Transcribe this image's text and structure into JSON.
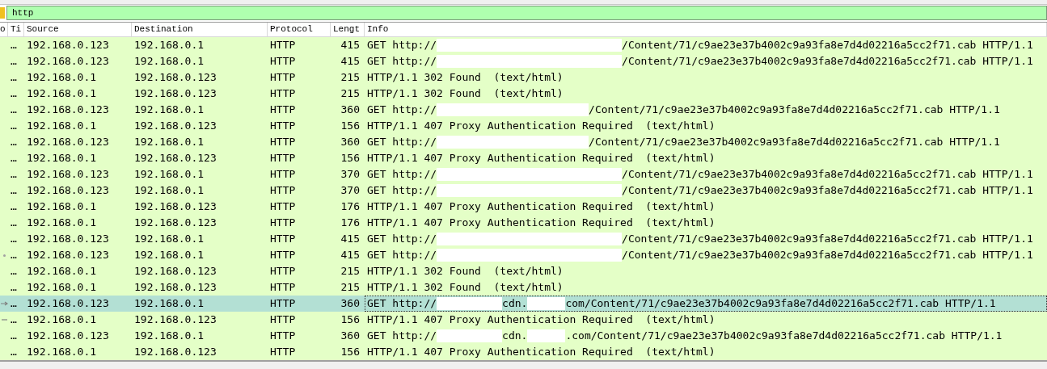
{
  "filter_bar": {
    "value": "http"
  },
  "table": {
    "columns": [
      "o",
      "Ti",
      "Source",
      "Destination",
      "Protocol",
      "Lengt",
      "Info"
    ],
    "rows": [
      {
        "time": "…",
        "source": "192.168.0.123",
        "destination": "192.168.0.1",
        "protocol": "HTTP",
        "length": "415",
        "selected": false,
        "info": [
          {
            "kind": "text",
            "text": "GET http://"
          },
          {
            "kind": "redaction-long"
          },
          {
            "kind": "text",
            "text": "/Content/71/c9ae23e37b4002c9a93fa8e7d4d02216a5cc2f71.cab HTTP/1.1"
          }
        ]
      },
      {
        "time": "…",
        "source": "192.168.0.123",
        "destination": "192.168.0.1",
        "protocol": "HTTP",
        "length": "415",
        "selected": false,
        "info": [
          {
            "kind": "text",
            "text": "GET http://"
          },
          {
            "kind": "redaction-long"
          },
          {
            "kind": "text",
            "text": "/Content/71/c9ae23e37b4002c9a93fa8e7d4d02216a5cc2f71.cab HTTP/1.1"
          }
        ]
      },
      {
        "time": "…",
        "source": "192.168.0.1",
        "destination": "192.168.0.123",
        "protocol": "HTTP",
        "length": "215",
        "selected": false,
        "info": [
          {
            "kind": "text",
            "text": "HTTP/1.1 302 Found  (text/html)"
          }
        ]
      },
      {
        "time": "…",
        "source": "192.168.0.1",
        "destination": "192.168.0.123",
        "protocol": "HTTP",
        "length": "215",
        "selected": false,
        "info": [
          {
            "kind": "text",
            "text": "HTTP/1.1 302 Found  (text/html)"
          }
        ]
      },
      {
        "time": "…",
        "source": "192.168.0.123",
        "destination": "192.168.0.1",
        "protocol": "HTTP",
        "length": "360",
        "selected": false,
        "info": [
          {
            "kind": "text",
            "text": "GET http://"
          },
          {
            "kind": "redaction-medium"
          },
          {
            "kind": "text",
            "text": "/Content/71/c9ae23e37b4002c9a93fa8e7d4d02216a5cc2f71.cab HTTP/1.1"
          }
        ]
      },
      {
        "time": "…",
        "source": "192.168.0.1",
        "destination": "192.168.0.123",
        "protocol": "HTTP",
        "length": "156",
        "selected": false,
        "info": [
          {
            "kind": "text",
            "text": "HTTP/1.1 407 Proxy Authentication Required  (text/html)"
          }
        ]
      },
      {
        "time": "…",
        "source": "192.168.0.123",
        "destination": "192.168.0.1",
        "protocol": "HTTP",
        "length": "360",
        "selected": false,
        "info": [
          {
            "kind": "text",
            "text": "GET http://"
          },
          {
            "kind": "redaction-medium"
          },
          {
            "kind": "text",
            "text": "/Content/71/c9ae23e37b4002c9a93fa8e7d4d02216a5cc2f71.cab HTTP/1.1"
          }
        ]
      },
      {
        "time": "…",
        "source": "192.168.0.1",
        "destination": "192.168.0.123",
        "protocol": "HTTP",
        "length": "156",
        "selected": false,
        "info": [
          {
            "kind": "text",
            "text": "HTTP/1.1 407 Proxy Authentication Required  (text/html)"
          }
        ]
      },
      {
        "time": "…",
        "source": "192.168.0.123",
        "destination": "192.168.0.1",
        "protocol": "HTTP",
        "length": "370",
        "selected": false,
        "info": [
          {
            "kind": "text",
            "text": "GET http://"
          },
          {
            "kind": "redaction-long"
          },
          {
            "kind": "text",
            "text": "/Content/71/c9ae23e37b4002c9a93fa8e7d4d02216a5cc2f71.cab HTTP/1.1"
          }
        ]
      },
      {
        "time": "…",
        "source": "192.168.0.123",
        "destination": "192.168.0.1",
        "protocol": "HTTP",
        "length": "370",
        "selected": false,
        "info": [
          {
            "kind": "text",
            "text": "GET http://"
          },
          {
            "kind": "redaction-long"
          },
          {
            "kind": "text",
            "text": "/Content/71/c9ae23e37b4002c9a93fa8e7d4d02216a5cc2f71.cab HTTP/1.1"
          }
        ]
      },
      {
        "time": "…",
        "source": "192.168.0.1",
        "destination": "192.168.0.123",
        "protocol": "HTTP",
        "length": "176",
        "selected": false,
        "info": [
          {
            "kind": "text",
            "text": "HTTP/1.1 407 Proxy Authentication Required  (text/html)"
          }
        ]
      },
      {
        "time": "…",
        "source": "192.168.0.1",
        "destination": "192.168.0.123",
        "protocol": "HTTP",
        "length": "176",
        "selected": false,
        "info": [
          {
            "kind": "text",
            "text": "HTTP/1.1 407 Proxy Authentication Required  (text/html)"
          }
        ]
      },
      {
        "time": "…",
        "source": "192.168.0.123",
        "destination": "192.168.0.1",
        "protocol": "HTTP",
        "length": "415",
        "selected": false,
        "info": [
          {
            "kind": "text",
            "text": "GET http://"
          },
          {
            "kind": "redaction-long"
          },
          {
            "kind": "text",
            "text": "/Content/71/c9ae23e37b4002c9a93fa8e7d4d02216a5cc2f71.cab HTTP/1.1"
          }
        ]
      },
      {
        "time": "…",
        "source": "192.168.0.123",
        "destination": "192.168.0.1",
        "protocol": "HTTP",
        "length": "415",
        "selected": false,
        "kind": "dot",
        "info": [
          {
            "kind": "text",
            "text": "GET http://"
          },
          {
            "kind": "redaction-long"
          },
          {
            "kind": "text",
            "text": "/Content/71/c9ae23e37b4002c9a93fa8e7d4d02216a5cc2f71.cab HTTP/1.1"
          }
        ]
      },
      {
        "time": "…",
        "source": "192.168.0.1",
        "destination": "192.168.0.123",
        "protocol": "HTTP",
        "length": "215",
        "selected": false,
        "info": [
          {
            "kind": "text",
            "text": "HTTP/1.1 302 Found  (text/html)"
          }
        ]
      },
      {
        "time": "…",
        "source": "192.168.0.1",
        "destination": "192.168.0.123",
        "protocol": "HTTP",
        "length": "215",
        "selected": false,
        "info": [
          {
            "kind": "text",
            "text": "HTTP/1.1 302 Found  (text/html)"
          }
        ]
      },
      {
        "time": "…",
        "source": "192.168.0.123",
        "destination": "192.168.0.1",
        "protocol": "HTTP",
        "length": "360",
        "selected": true,
        "kind": "arrow",
        "info": [
          {
            "kind": "text",
            "text": "GET http://"
          },
          {
            "kind": "redaction-short"
          },
          {
            "kind": "text",
            "text": "cdn."
          },
          {
            "kind": "redaction-tiny"
          },
          {
            "kind": "text",
            "text": "com/Content/71/c9ae23e37b4002c9a93fa8e7d4d02216a5cc2f71.cab HTTP/1.1"
          }
        ]
      },
      {
        "time": "…",
        "source": "192.168.0.1",
        "destination": "192.168.0.123",
        "protocol": "HTTP",
        "length": "156",
        "selected": false,
        "kind": "line",
        "info": [
          {
            "kind": "text",
            "text": "HTTP/1.1 407 Proxy Authentication Required  (text/html)"
          }
        ]
      },
      {
        "time": "…",
        "source": "192.168.0.123",
        "destination": "192.168.0.1",
        "protocol": "HTTP",
        "length": "360",
        "selected": false,
        "info": [
          {
            "kind": "text",
            "text": "GET http://"
          },
          {
            "kind": "redaction-short"
          },
          {
            "kind": "text",
            "text": "cdn."
          },
          {
            "kind": "redaction-tiny"
          },
          {
            "kind": "text",
            "text": ".com/Content/71/c9ae23e37b4002c9a93fa8e7d4d02216a5cc2f71.cab HTTP/1.1"
          }
        ]
      },
      {
        "time": "…",
        "source": "192.168.0.1",
        "destination": "192.168.0.123",
        "protocol": "HTTP",
        "length": "156",
        "selected": false,
        "info": [
          {
            "kind": "text",
            "text": "HTTP/1.1 407 Proxy Authentication Required  (text/html)"
          }
        ]
      }
    ]
  }
}
